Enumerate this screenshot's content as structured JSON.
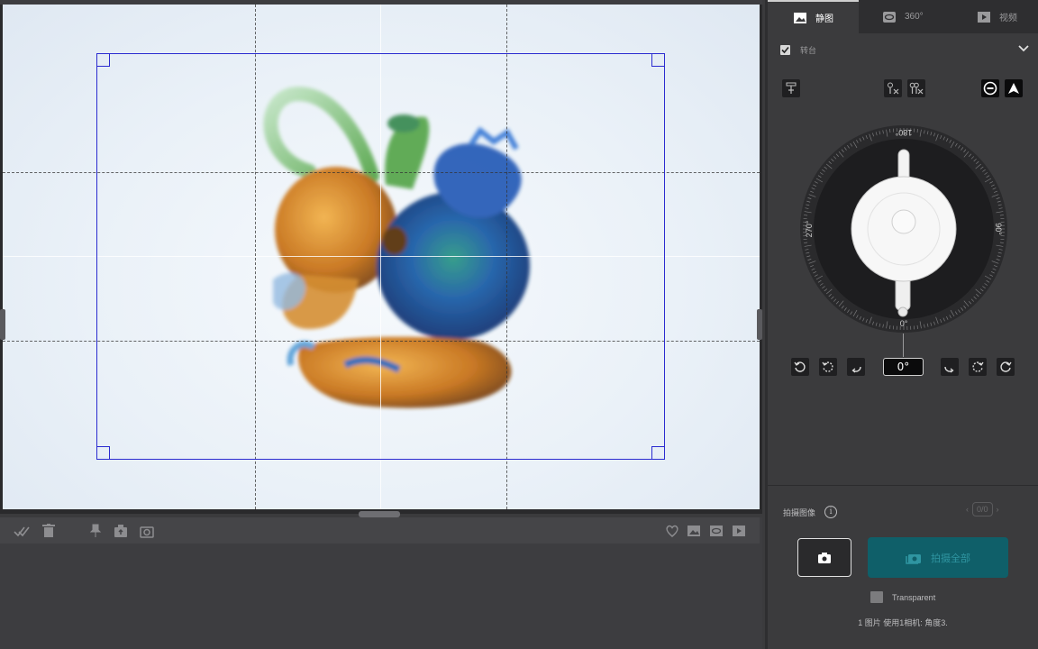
{
  "tabs": [
    {
      "label": "静图",
      "icon": "image-icon",
      "active": true
    },
    {
      "label": "360°",
      "icon": "rotate-360-icon",
      "active": false
    },
    {
      "label": "视频",
      "icon": "play-icon",
      "active": false
    }
  ],
  "turntable": {
    "label": "转台",
    "checked": true
  },
  "dial": {
    "labels": {
      "top": "180°",
      "right": "90°",
      "bottom": "0°",
      "left": "270°"
    },
    "current_angle": "0°"
  },
  "capture": {
    "label": "拍摄图像",
    "pager": "0/0",
    "shoot_all_label": "拍摄全部",
    "background_option": "Transparent",
    "summary": "1 图片 使用1相机: 角度3."
  },
  "colors": {
    "crop_border": "#2b2bd0",
    "shoot_all_bg": "#0f5f69",
    "shoot_all_text": "#2f95a1"
  }
}
